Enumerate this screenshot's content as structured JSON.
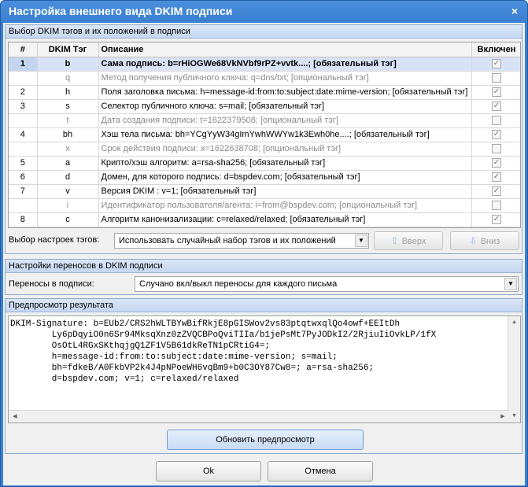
{
  "window": {
    "title": "Настройка внешнего вида DKIM подписи",
    "close_glyph": "×"
  },
  "tags_group": {
    "header": "Выбор DKIM тэгов и их положений в подписи",
    "columns": {
      "num": "#",
      "tag": "DKIM Тэг",
      "desc": "Описание",
      "enabled": "Включен"
    },
    "rows": [
      {
        "num": "1",
        "tag": "b",
        "desc": "Сама подпись: b=rHiOGWe68VkNVbf9rPZ+vvtk....; [обязательный тэг]",
        "enabled": true,
        "optional": false,
        "selected": true
      },
      {
        "num": "",
        "tag": "q",
        "desc": "Метод получения публичного ключа: q=dns/txt; [опциональный тэг]",
        "enabled": false,
        "optional": true,
        "selected": false
      },
      {
        "num": "2",
        "tag": "h",
        "desc": "Поля заголовка письма: h=message-id:from:to:subject:date:mime-version; [обязательный тэг]",
        "enabled": true,
        "optional": false,
        "selected": false
      },
      {
        "num": "3",
        "tag": "s",
        "desc": "Селектор публичного ключа: s=mail; [обязательный тэг]",
        "enabled": true,
        "optional": false,
        "selected": false
      },
      {
        "num": "",
        "tag": "t",
        "desc": "Дата создания подписи: t=1622379508; [опциональный тэг]",
        "enabled": false,
        "optional": true,
        "selected": false
      },
      {
        "num": "4",
        "tag": "bh",
        "desc": "Хэш тела письма: bh=YCgYyW34gImYwhWWYw1k3Ewh0he....; [обязательный тэг]",
        "enabled": true,
        "optional": false,
        "selected": false
      },
      {
        "num": "",
        "tag": "x",
        "desc": "Срок действия подписи: x=1622638708; [опциональный тэг]",
        "enabled": false,
        "optional": true,
        "selected": false
      },
      {
        "num": "5",
        "tag": "a",
        "desc": "Крипто/хэш алгоритм: a=rsa-sha256; [обязательный тэг]",
        "enabled": true,
        "optional": false,
        "selected": false
      },
      {
        "num": "6",
        "tag": "d",
        "desc": "Домен, для которого подпись: d=bspdev.com; [обязательный тэг]",
        "enabled": true,
        "optional": false,
        "selected": false
      },
      {
        "num": "7",
        "tag": "v",
        "desc": "Версия DKIM : v=1; [обязательный тэг]",
        "enabled": true,
        "optional": false,
        "selected": false
      },
      {
        "num": "",
        "tag": "i",
        "desc": "Идентификатор пользователя/агента: i=from@bspdev.com; [опциональный тэг]",
        "enabled": false,
        "optional": true,
        "selected": false
      },
      {
        "num": "8",
        "tag": "c",
        "desc": "Алгоритм канонизализации: c=relaxed/relaxed; [обязательный тэг]",
        "enabled": true,
        "optional": false,
        "selected": false
      }
    ],
    "preset_label": "Выбор настроек тэгов:",
    "preset_value": "Использовать случайный набор тэгов и их положений",
    "up_button": "Вверх",
    "down_button": "Вниз"
  },
  "wrap_group": {
    "header": "Настройки переносов в DKIM подписи",
    "label": "Переносы в подписи:",
    "value": "Случано вкл/выкл переносы для каждого письма"
  },
  "preview_group": {
    "header": "Предпросмотр результата",
    "lines": [
      "DKIM-Signature: b=EUb2/CRS2hWLTBYwBifRkjE8pGISWov2vs83ptqtwxqlQo4owf+EEItDh",
      "        Ly6pDqyiO0n6Sr94MksqXnz0zZVQCBPoQviTIIa/b1jePsMt7PyJODkI2/2RjiuIiOvkLP/1fX",
      "        OsOtL4RGxSKthqjgQ1ZF1V5B61dkReTN1pCRtiG4=;",
      "        h=message-id:from:to:subject:date:mime-version; s=mail;",
      "        bh=fdkeB/A0FkbVP2k4J4pNPoeWH6vqBm9+b0C3OY87Cw8=; a=rsa-sha256;",
      "        d=bspdev.com; v=1; c=relaxed/relaxed"
    ],
    "refresh_button": "Обновить предпросмотр"
  },
  "dialog_buttons": {
    "ok": "Ok",
    "cancel": "Отмена"
  },
  "icons": {
    "check": "✓",
    "combo_arrow": "▼",
    "up_arrow": "⇧",
    "down_arrow": "⇩",
    "scroll_up": "▲",
    "scroll_down": "▼",
    "scroll_left": "◀",
    "scroll_right": "▶"
  }
}
